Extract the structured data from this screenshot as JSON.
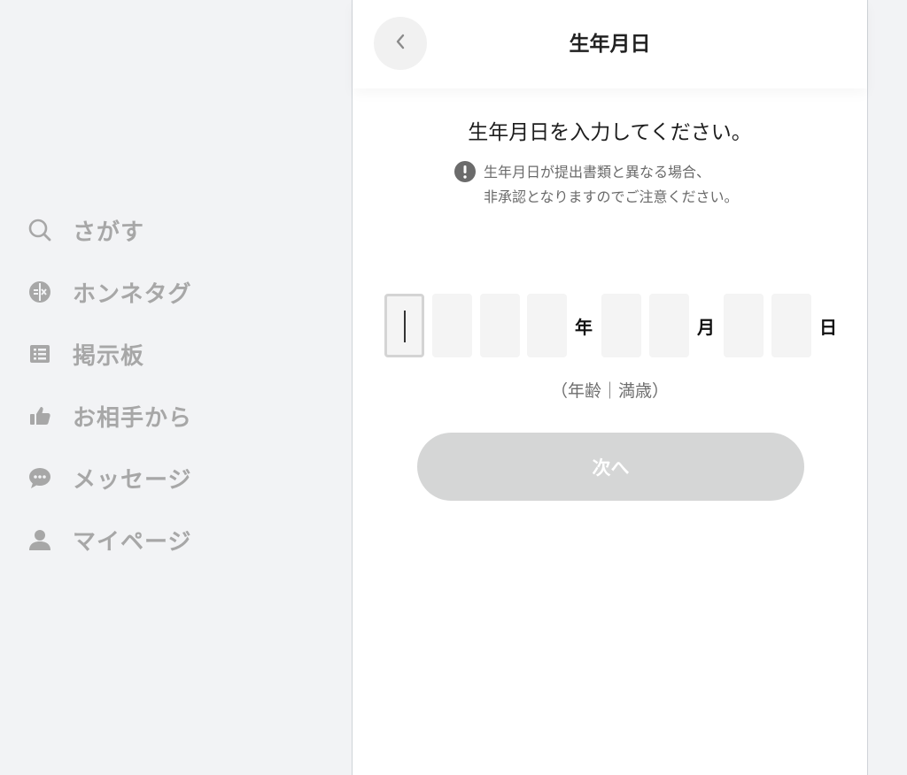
{
  "sidebar": {
    "items": [
      {
        "label": "さがす",
        "icon": "search-icon"
      },
      {
        "label": "ホンネタグ",
        "icon": "tag-icon"
      },
      {
        "label": "掲示板",
        "icon": "board-icon"
      },
      {
        "label": "お相手から",
        "icon": "thumbs-up-icon"
      },
      {
        "label": "メッセージ",
        "icon": "chat-bubble-icon"
      },
      {
        "label": "マイページ",
        "icon": "person-icon"
      }
    ]
  },
  "header": {
    "title": "生年月日",
    "back_icon": "chevron-left-icon"
  },
  "main": {
    "prompt": "生年月日を入力してください。",
    "notice": {
      "icon": "exclamation-icon",
      "line1": "生年月日が提出書類と異なる場合、",
      "line2": "非承認となりますのでご注意ください。"
    },
    "date_units": {
      "year": "年",
      "month": "月",
      "day": "日"
    },
    "age_display": "（年齢｜満歳）",
    "next_button": "次へ"
  },
  "colors": {
    "background": "#f2f3f5",
    "panel": "#ffffff",
    "nav_text": "#a7a7a7",
    "button_disabled": "#d5d6d6"
  }
}
